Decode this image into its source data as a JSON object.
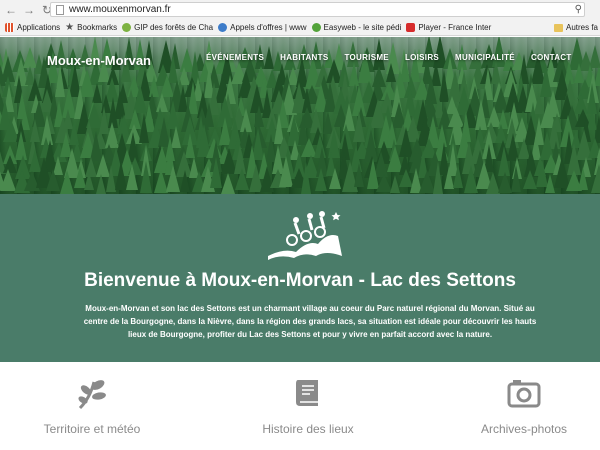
{
  "browser": {
    "url": "www.mouxenmorvan.fr",
    "bookmarks": [
      {
        "label": "Applications",
        "icon": "apps-grid-icon",
        "color": "#e0522c"
      },
      {
        "label": "Bookmarks",
        "icon": "star-icon",
        "color": "#555555"
      },
      {
        "label": "GIP des forêts de Cha",
        "icon": "leaf-icon",
        "color": "#7db242"
      },
      {
        "label": "Appels d'offres | www",
        "icon": "globe-icon",
        "color": "#3d7cc9"
      },
      {
        "label": "Easyweb - le site pédi",
        "icon": "easyweb-icon",
        "color": "#53a33a"
      },
      {
        "label": "Player - France Inter",
        "icon": "france-inter-icon",
        "color": "#d62c2c"
      }
    ],
    "other_bookmarks": "Autres fa"
  },
  "header": {
    "site_title": "Moux-en-Morvan",
    "menu": [
      "ÉVÉNEMENTS",
      "HABITANTS",
      "TOURISME",
      "LOISIRS",
      "MUNICIPALITÉ",
      "CONTACT"
    ]
  },
  "welcome": {
    "title": "Bienvenue à Moux-en-Morvan - Lac des Settons",
    "text": "Moux-en-Morvan et son lac des Settons est un charmant village au coeur du Parc naturel régional du Morvan. Situé au centre de la Bourgogne, dans la Nièvre, dans la région des grands lacs, sa situation est idéale pour découvrir les hauts lieux de Bourgogne, profiter du Lac des Settons et pour y vivre en parfait accord avec la nature."
  },
  "tiles": [
    {
      "label": "Territoire et météo",
      "icon": "leaf-branch-icon"
    },
    {
      "label": "Histoire des lieux",
      "icon": "book-icon"
    },
    {
      "label": "Archives-photos",
      "icon": "camera-icon"
    }
  ],
  "colors": {
    "band": "#4a7c69",
    "tile_icon": "#8a8a8a"
  }
}
